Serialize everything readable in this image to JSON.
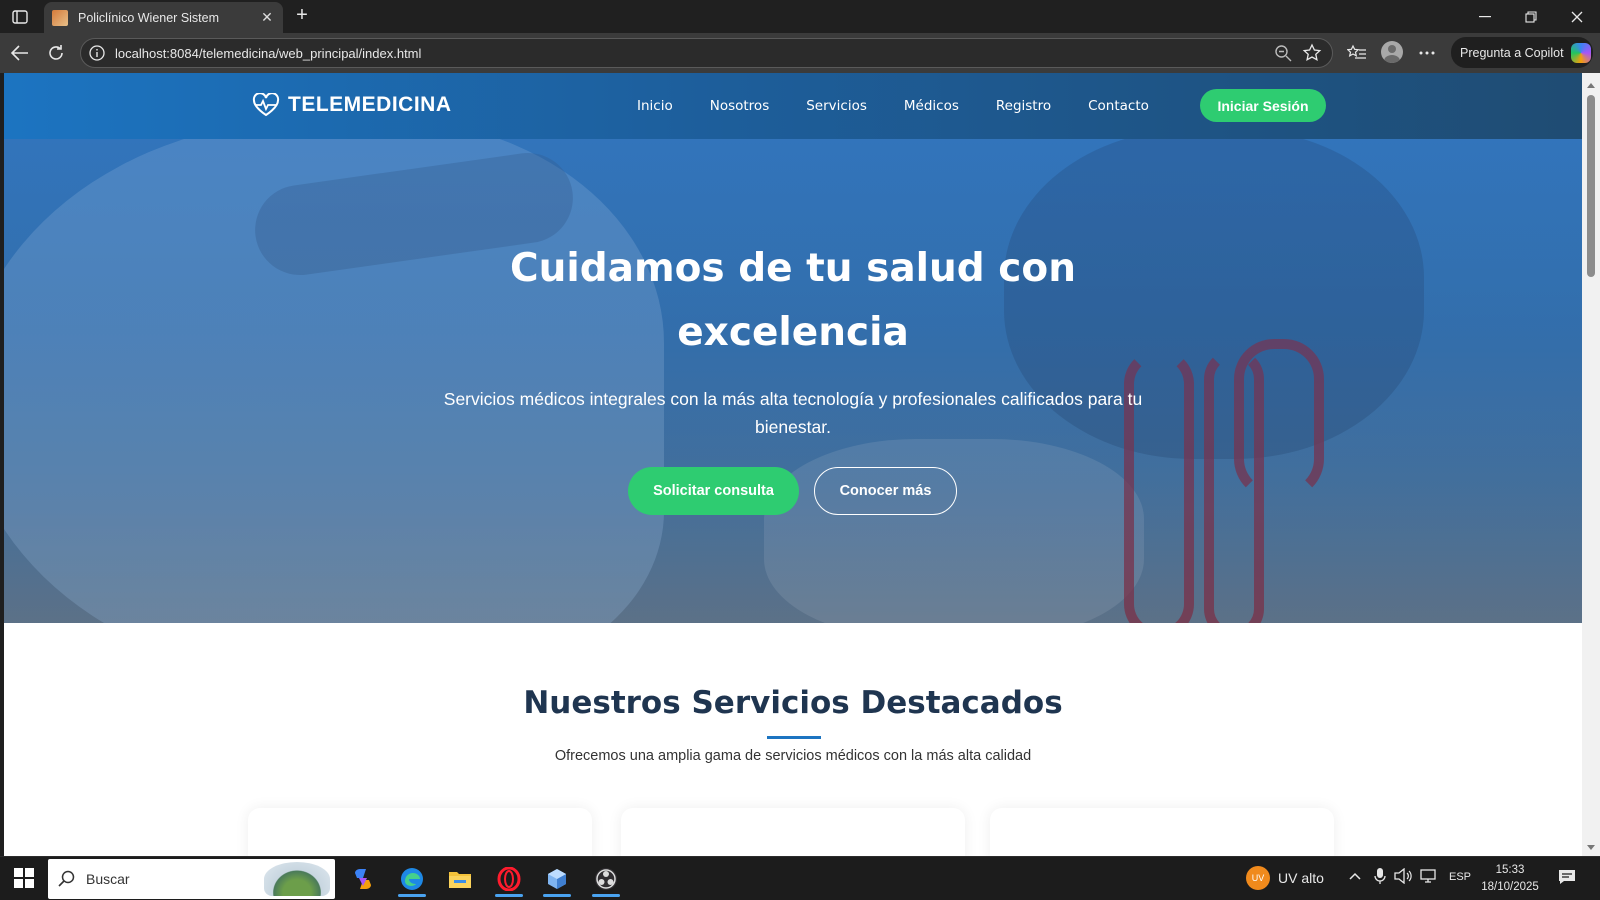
{
  "browser": {
    "tab_title": "Policlínico Wiener Sistem",
    "url": "localhost:8084/telemedicina/web_principal/index.html",
    "copilot_label": "Pregunta a Copilot"
  },
  "site": {
    "logo_text": "TELEMEDICINA",
    "nav": [
      "Inicio",
      "Nosotros",
      "Servicios",
      "Médicos",
      "Registro",
      "Contacto"
    ],
    "login_label": "Iniciar Sesión"
  },
  "hero": {
    "title_line1": "Cuidamos de tu salud con",
    "title_line2": "excelencia",
    "subtitle": "Servicios médicos integrales con la más alta tecnología y profesionales calificados para tu bienestar.",
    "primary_cta": "Solicitar consulta",
    "secondary_cta": "Conocer más"
  },
  "services": {
    "title": "Nuestros Servicios Destacados",
    "subtitle": "Ofrecemos una amplia gama de servicios médicos con la más alta calidad"
  },
  "taskbar": {
    "search_placeholder": "Buscar",
    "uv_badge": "UV",
    "uv_label": "UV alto",
    "language": "ESP",
    "time": "15:33",
    "date": "18/10/2025"
  },
  "colors": {
    "brand_green": "#2ecc71",
    "brand_blue": "#1c74c1",
    "heading_navy": "#1f3550"
  },
  "icons": [
    "tab-actions-icon",
    "favicon",
    "close-icon",
    "plus-icon",
    "minimize-icon",
    "restore-icon",
    "window-close-icon",
    "back-icon",
    "refresh-icon",
    "info-icon",
    "zoom-out-icon",
    "favorite-star-icon",
    "favorites-icon",
    "profile-avatar",
    "more-icon",
    "copilot-icon",
    "heart-pulse-icon",
    "windows-start-icon",
    "search-icon",
    "copilot-app-icon",
    "edge-icon",
    "file-explorer-icon",
    "opera-icon",
    "app-cube-icon",
    "obs-icon",
    "chevron-up-icon",
    "mic-icon",
    "speaker-icon",
    "network-icon",
    "notification-icon"
  ]
}
